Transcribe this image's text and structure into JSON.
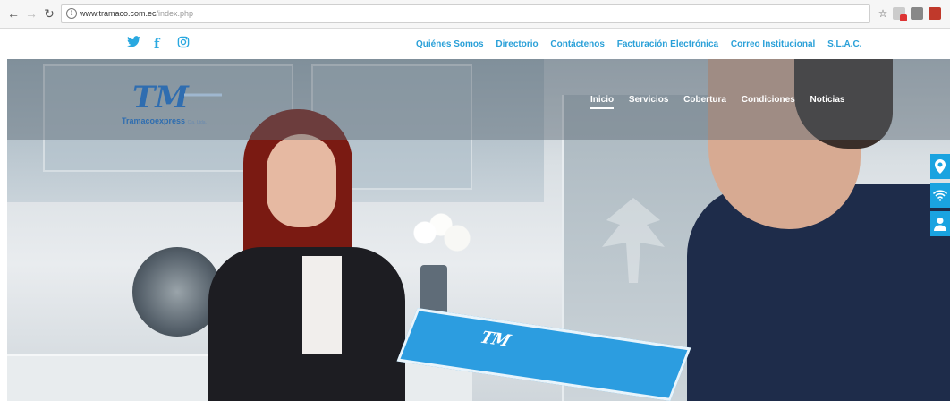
{
  "browser": {
    "url_host": "www.tramaco.com.ec",
    "url_path": "/index.php",
    "info_glyph": "i"
  },
  "social": {
    "icons": [
      "twitter-icon",
      "facebook-icon",
      "instagram-icon"
    ]
  },
  "top_nav": {
    "items": [
      "Quiénes Somos",
      "Directorio",
      "Contáctenos",
      "Facturación Electrónica",
      "Correo Institucional",
      "S.L.A.C."
    ]
  },
  "brand": {
    "logo_monogram": "TM",
    "logo_text": "Tramacoexpress",
    "logo_sub": "Cia. Ltda.",
    "box_monogram": "TM"
  },
  "main_nav": {
    "items": [
      "Inicio",
      "Servicios",
      "Cobertura",
      "Condiciones",
      "Noticias"
    ],
    "active": "Inicio"
  },
  "side_buttons": [
    "map-pin-icon",
    "wifi-icon",
    "user-icon"
  ],
  "colors": {
    "accent": "#29a8e0",
    "side_button": "#1aa3e0",
    "logo": "#2f6db0"
  }
}
